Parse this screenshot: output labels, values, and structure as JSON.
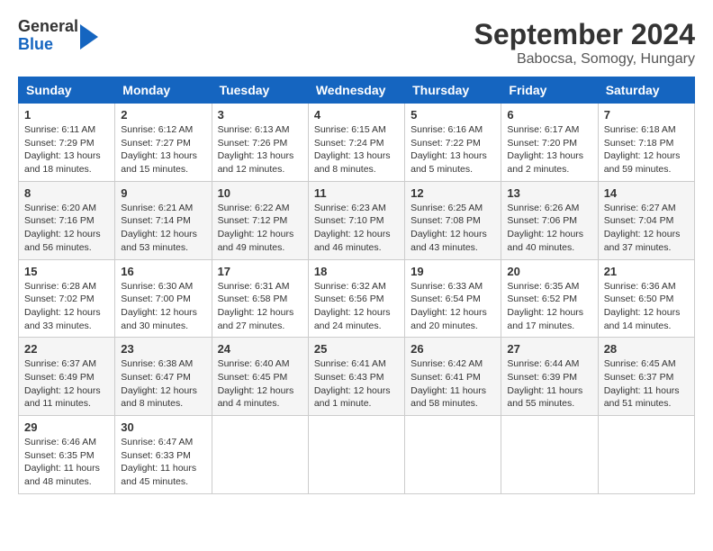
{
  "logo": {
    "general": "General",
    "blue": "Blue"
  },
  "title": "September 2024",
  "subtitle": "Babocsa, Somogy, Hungary",
  "days_of_week": [
    "Sunday",
    "Monday",
    "Tuesday",
    "Wednesday",
    "Thursday",
    "Friday",
    "Saturday"
  ],
  "weeks": [
    [
      {
        "day": 1,
        "sunrise": "6:11 AM",
        "sunset": "7:29 PM",
        "daylight": "13 hours and 18 minutes."
      },
      {
        "day": 2,
        "sunrise": "6:12 AM",
        "sunset": "7:27 PM",
        "daylight": "13 hours and 15 minutes."
      },
      {
        "day": 3,
        "sunrise": "6:13 AM",
        "sunset": "7:26 PM",
        "daylight": "13 hours and 12 minutes."
      },
      {
        "day": 4,
        "sunrise": "6:15 AM",
        "sunset": "7:24 PM",
        "daylight": "13 hours and 8 minutes."
      },
      {
        "day": 5,
        "sunrise": "6:16 AM",
        "sunset": "7:22 PM",
        "daylight": "13 hours and 5 minutes."
      },
      {
        "day": 6,
        "sunrise": "6:17 AM",
        "sunset": "7:20 PM",
        "daylight": "13 hours and 2 minutes."
      },
      {
        "day": 7,
        "sunrise": "6:18 AM",
        "sunset": "7:18 PM",
        "daylight": "12 hours and 59 minutes."
      }
    ],
    [
      {
        "day": 8,
        "sunrise": "6:20 AM",
        "sunset": "7:16 PM",
        "daylight": "12 hours and 56 minutes."
      },
      {
        "day": 9,
        "sunrise": "6:21 AM",
        "sunset": "7:14 PM",
        "daylight": "12 hours and 53 minutes."
      },
      {
        "day": 10,
        "sunrise": "6:22 AM",
        "sunset": "7:12 PM",
        "daylight": "12 hours and 49 minutes."
      },
      {
        "day": 11,
        "sunrise": "6:23 AM",
        "sunset": "7:10 PM",
        "daylight": "12 hours and 46 minutes."
      },
      {
        "day": 12,
        "sunrise": "6:25 AM",
        "sunset": "7:08 PM",
        "daylight": "12 hours and 43 minutes."
      },
      {
        "day": 13,
        "sunrise": "6:26 AM",
        "sunset": "7:06 PM",
        "daylight": "12 hours and 40 minutes."
      },
      {
        "day": 14,
        "sunrise": "6:27 AM",
        "sunset": "7:04 PM",
        "daylight": "12 hours and 37 minutes."
      }
    ],
    [
      {
        "day": 15,
        "sunrise": "6:28 AM",
        "sunset": "7:02 PM",
        "daylight": "12 hours and 33 minutes."
      },
      {
        "day": 16,
        "sunrise": "6:30 AM",
        "sunset": "7:00 PM",
        "daylight": "12 hours and 30 minutes."
      },
      {
        "day": 17,
        "sunrise": "6:31 AM",
        "sunset": "6:58 PM",
        "daylight": "12 hours and 27 minutes."
      },
      {
        "day": 18,
        "sunrise": "6:32 AM",
        "sunset": "6:56 PM",
        "daylight": "12 hours and 24 minutes."
      },
      {
        "day": 19,
        "sunrise": "6:33 AM",
        "sunset": "6:54 PM",
        "daylight": "12 hours and 20 minutes."
      },
      {
        "day": 20,
        "sunrise": "6:35 AM",
        "sunset": "6:52 PM",
        "daylight": "12 hours and 17 minutes."
      },
      {
        "day": 21,
        "sunrise": "6:36 AM",
        "sunset": "6:50 PM",
        "daylight": "12 hours and 14 minutes."
      }
    ],
    [
      {
        "day": 22,
        "sunrise": "6:37 AM",
        "sunset": "6:49 PM",
        "daylight": "12 hours and 11 minutes."
      },
      {
        "day": 23,
        "sunrise": "6:38 AM",
        "sunset": "6:47 PM",
        "daylight": "12 hours and 8 minutes."
      },
      {
        "day": 24,
        "sunrise": "6:40 AM",
        "sunset": "6:45 PM",
        "daylight": "12 hours and 4 minutes."
      },
      {
        "day": 25,
        "sunrise": "6:41 AM",
        "sunset": "6:43 PM",
        "daylight": "12 hours and 1 minute."
      },
      {
        "day": 26,
        "sunrise": "6:42 AM",
        "sunset": "6:41 PM",
        "daylight": "11 hours and 58 minutes."
      },
      {
        "day": 27,
        "sunrise": "6:44 AM",
        "sunset": "6:39 PM",
        "daylight": "11 hours and 55 minutes."
      },
      {
        "day": 28,
        "sunrise": "6:45 AM",
        "sunset": "6:37 PM",
        "daylight": "11 hours and 51 minutes."
      }
    ],
    [
      {
        "day": 29,
        "sunrise": "6:46 AM",
        "sunset": "6:35 PM",
        "daylight": "11 hours and 48 minutes."
      },
      {
        "day": 30,
        "sunrise": "6:47 AM",
        "sunset": "6:33 PM",
        "daylight": "11 hours and 45 minutes."
      },
      null,
      null,
      null,
      null,
      null
    ]
  ]
}
